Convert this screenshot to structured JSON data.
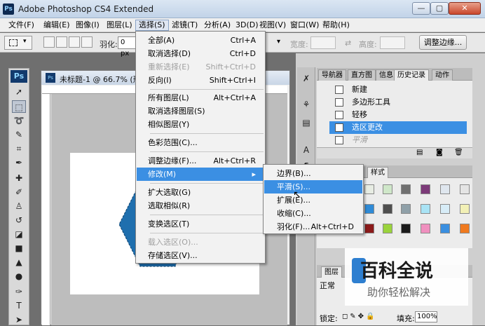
{
  "window": {
    "title": "Adobe Photoshop CS4 Extended"
  },
  "menubar": [
    "文件(F)",
    "编辑(E)",
    "图像(I)",
    "图层(L)",
    "选择(S)",
    "滤镜(T)",
    "分析(A)",
    "3D(D)",
    "视图(V)",
    "窗口(W)",
    "帮助(H)"
  ],
  "options": {
    "feather_label": "羽化:",
    "feather_value": "0 px",
    "width_label": "宽度:",
    "height_label": "高度:",
    "refine_edge_button": "调整边缘..."
  },
  "toolbox": {
    "logo": "Ps"
  },
  "document": {
    "title": "未标题-1 @ 66.7% (形"
  },
  "select_menu": {
    "items": [
      {
        "label": "全部(A)",
        "shortcut": "Ctrl+A",
        "enabled": true
      },
      {
        "label": "取消选择(D)",
        "shortcut": "Ctrl+D",
        "enabled": true
      },
      {
        "label": "重新选择(E)",
        "shortcut": "Shift+Ctrl+D",
        "enabled": false
      },
      {
        "label": "反向(I)",
        "shortcut": "Shift+Ctrl+I",
        "enabled": true
      },
      {
        "label": "所有图层(L)",
        "shortcut": "Alt+Ctrl+A",
        "enabled": true
      },
      {
        "label": "取消选择图层(S)",
        "shortcut": "",
        "enabled": true
      },
      {
        "label": "相似图层(Y)",
        "shortcut": "",
        "enabled": true
      },
      {
        "label": "色彩范围(C)...",
        "shortcut": "",
        "enabled": true
      },
      {
        "label": "调整边缘(F)...",
        "shortcut": "Alt+Ctrl+R",
        "enabled": true
      },
      {
        "label": "修改(M)",
        "shortcut": "",
        "enabled": true
      },
      {
        "label": "扩大选取(G)",
        "shortcut": "",
        "enabled": true
      },
      {
        "label": "选取相似(R)",
        "shortcut": "",
        "enabled": true
      },
      {
        "label": "变换选区(T)",
        "shortcut": "",
        "enabled": true
      },
      {
        "label": "载入选区(O)...",
        "shortcut": "",
        "enabled": false
      },
      {
        "label": "存储选区(V)...",
        "shortcut": "",
        "enabled": true
      }
    ]
  },
  "modify_submenu": {
    "items": [
      {
        "label": "边界(B)...",
        "shortcut": ""
      },
      {
        "label": "平滑(S)...",
        "shortcut": ""
      },
      {
        "label": "扩展(E)...",
        "shortcut": ""
      },
      {
        "label": "收缩(C)...",
        "shortcut": ""
      },
      {
        "label": "羽化(F)...",
        "shortcut": "Alt+Ctrl+D"
      }
    ]
  },
  "panels": {
    "tabs_top": [
      "导航器",
      "直方图",
      "信息",
      "历史记录",
      "动作"
    ],
    "history": [
      "新建",
      "多边形工具",
      "轻移",
      "选区更改",
      "平滑"
    ],
    "styles_tab": "样式",
    "layers_tab": "图层",
    "blend_mode": "正常",
    "lock_label": "锁定:",
    "fill_label": "填充:",
    "fill_value": "100%"
  },
  "watermark": {
    "title": "百科全说",
    "subtitle": "助你轻松解决"
  },
  "colors": {
    "accent": "#3b8fe3",
    "shape": "#1f6fae"
  }
}
